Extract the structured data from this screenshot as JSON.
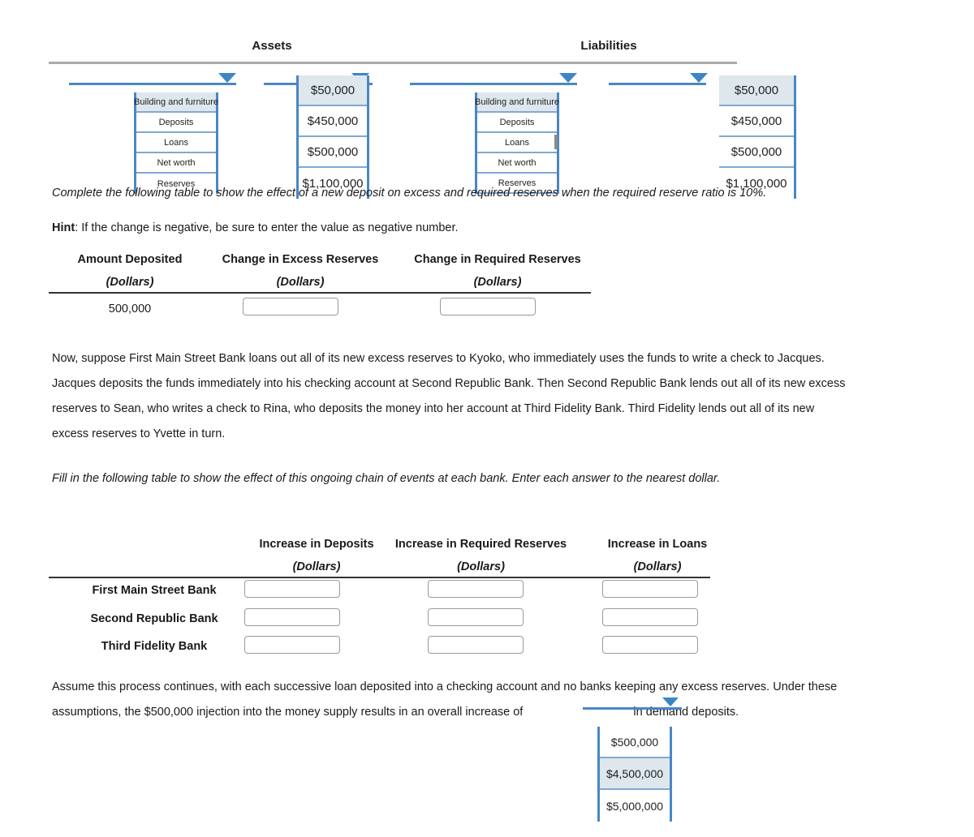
{
  "balance_sheet": {
    "assets_title": "Assets",
    "liabilities_title": "Liabilities"
  },
  "dropdowns": {
    "assets_label": {
      "name": "assets-label-dropdown",
      "options": [
        "Building and furniture",
        "Deposits",
        "Loans",
        "Net worth",
        "Reserves"
      ],
      "selected": "Building and furniture"
    },
    "assets_amount": {
      "name": "assets-amount-dropdown",
      "options": [
        "$50,000",
        "$450,000",
        "$500,000",
        "$1,100,000"
      ],
      "selected": "$50,000"
    },
    "liabilities_label": {
      "name": "liabilities-label-dropdown",
      "options": [
        "Building and furniture",
        "Deposits",
        "Loans",
        "Net worth",
        "Reserves"
      ],
      "selected": "Building and furniture"
    },
    "liabilities_amount": {
      "name": "liabilities-amount-dropdown",
      "options": [
        "$50,000",
        "$450,000",
        "$500,000",
        "$1,100,000"
      ],
      "selected": "$50,000"
    },
    "overall_increase": {
      "name": "overall-increase-dropdown",
      "options": [
        "$500,000",
        "$4,500,000",
        "$5,000,000"
      ],
      "selected": "$4,500,000"
    }
  },
  "instructions": {
    "complete_table": "Complete the following table to show the effect of a new deposit on excess and required reserves when the required reserve ratio is 10%.",
    "hint_label": "Hint",
    "hint_text": ": If the change is negative, be sure to enter the value as negative number.",
    "fill_table": "Fill in the following table to show the effect of this ongoing chain of events at each bank. Enter each answer to the nearest dollar."
  },
  "paragraphs": {
    "chain_line1": "Now, suppose First Main Street Bank loans out all of its new excess reserves to Kyoko, who immediately uses the funds to write a check to Jacques.",
    "chain_line2": "Jacques deposits the funds immediately into his checking account at Second Republic Bank. Then Second Republic Bank lends out all of its new excess",
    "chain_line3": "reserves to Sean, who writes a check to Rina, who deposits the money into her account at Third Fidelity Bank. Third Fidelity lends out all of its new",
    "chain_line4": "excess reserves to Yvette in turn.",
    "assume_line1": "Assume this process continues, with each successive loan deposited into a checking account and no banks keeping any excess reserves. Under these",
    "assume_line2_a": "assumptions, the $500,000 injection into the money supply results in an overall increase of",
    "assume_line2_b": "in demand deposits."
  },
  "table_deposit": {
    "headers": [
      "Amount Deposited",
      "Change in Excess Reserves",
      "Change in Required Reserves"
    ],
    "subheaders": [
      "(Dollars)",
      "(Dollars)",
      "(Dollars)"
    ],
    "rows": [
      {
        "amount_deposited": "500,000",
        "change_excess_reserves": "",
        "change_required_reserves": ""
      }
    ]
  },
  "table_banks": {
    "headers": [
      "Increase in Deposits",
      "Increase in Required Reserves",
      "Increase in Loans"
    ],
    "subheaders": [
      "(Dollars)",
      "(Dollars)",
      "(Dollars)"
    ],
    "rows": [
      {
        "bank": "First Main Street Bank",
        "deposits": "",
        "required_reserves": "",
        "loans": ""
      },
      {
        "bank": "Second Republic Bank",
        "deposits": "",
        "required_reserves": "",
        "loans": ""
      },
      {
        "bank": "Third Fidelity Bank",
        "deposits": "",
        "required_reserves": "",
        "loans": ""
      }
    ]
  },
  "colors": {
    "accent_blue": "#4a87c4",
    "caret_blue": "#3d85c6",
    "selected_bg": "#dde7ec",
    "rule_gray": "#aaaaaa",
    "box_border": "#9a9a9a"
  }
}
